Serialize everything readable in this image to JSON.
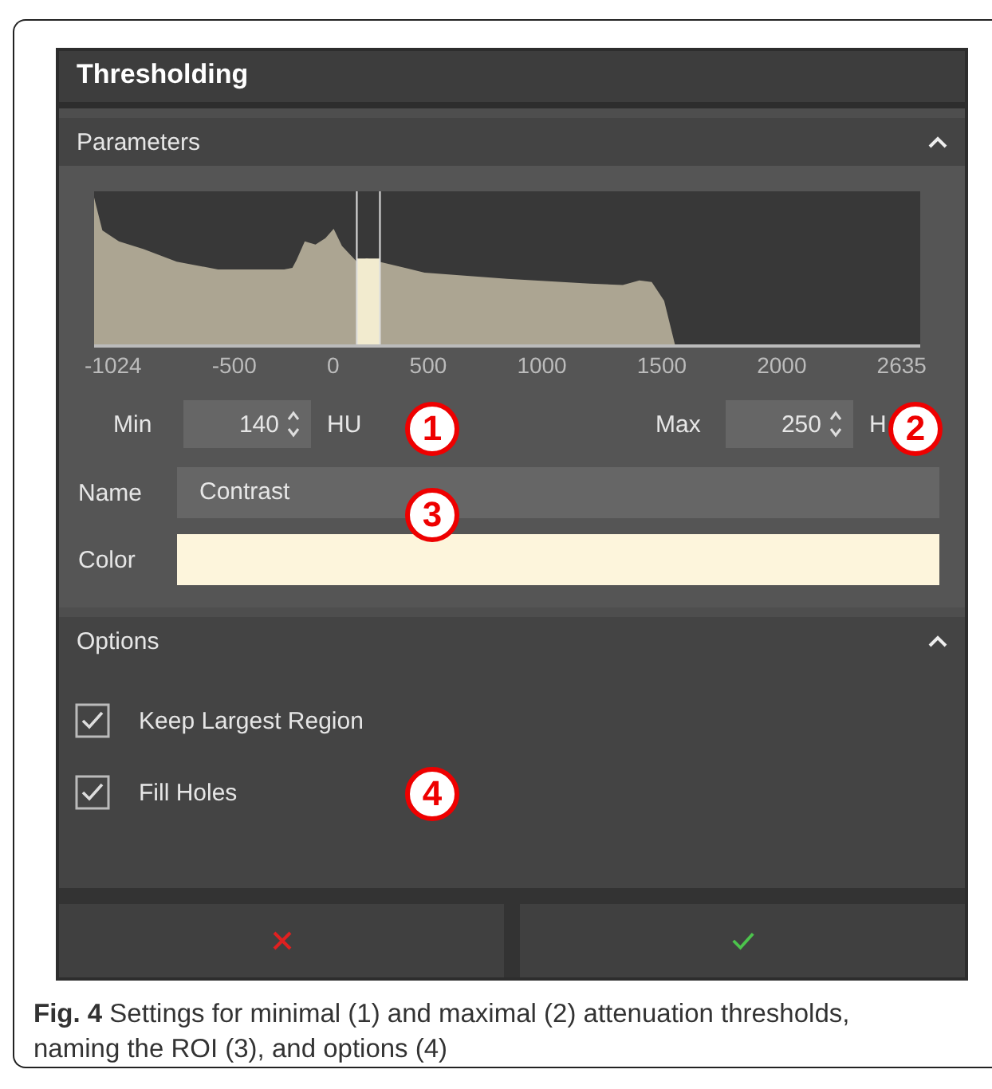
{
  "panel": {
    "title": "Thresholding"
  },
  "parameters": {
    "header": "Parameters",
    "axis_labels": [
      "-1024",
      "-500",
      "0",
      "500",
      "1000",
      "1500",
      "2000",
      "2635"
    ],
    "min": {
      "label": "Min",
      "value": "140",
      "unit": "HU"
    },
    "max": {
      "label": "Max",
      "value": "250",
      "unit": "H"
    },
    "name": {
      "label": "Name",
      "value": "Contrast"
    },
    "color": {
      "label": "Color",
      "color": "#fdf5dc"
    }
  },
  "options": {
    "header": "Options",
    "items": [
      {
        "label": "Keep Largest Region",
        "checked": true
      },
      {
        "label": "Fill Holes",
        "checked": true
      }
    ]
  },
  "callouts": [
    "1",
    "2",
    "3",
    "4"
  ],
  "caption": "**Fig. 4** Settings for minimal (1) and maximal (2) attenuation thresholds, naming the ROI (3), and options (4)"
}
